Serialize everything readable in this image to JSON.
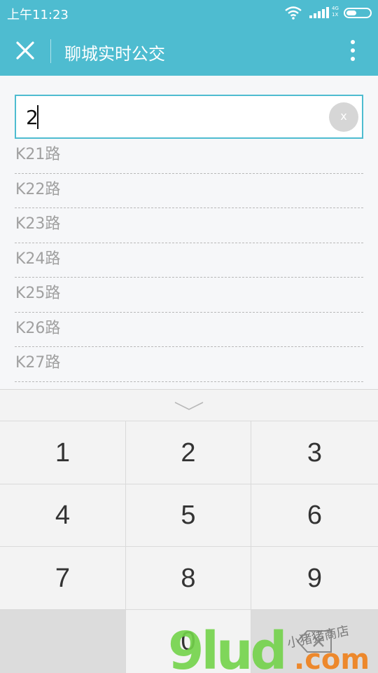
{
  "status_bar": {
    "time": "上午11:23",
    "network_top": "4G",
    "network_bottom": "1X",
    "icons": [
      "wifi-icon",
      "signal-icon",
      "battery-icon"
    ]
  },
  "app_bar": {
    "title": "聊城实时公交",
    "close_icon": "close-icon",
    "more_icon": "more-icon",
    "color": "#4ebcd0"
  },
  "search": {
    "value": "2",
    "clear_label": "x"
  },
  "suggestions": [
    "K21路",
    "K22路",
    "K23路",
    "K24路",
    "K25路",
    "K26路",
    "K27路"
  ],
  "keypad": {
    "collapse_icon": "chevron-down-icon",
    "keys": [
      "1",
      "2",
      "3",
      "4",
      "5",
      "6",
      "7",
      "8",
      "9",
      "",
      "0",
      ""
    ],
    "delete_icon": "backspace-icon"
  },
  "watermark": {
    "logo_text": "9lud",
    "domain_text": ".com",
    "tagline": "小猪猪商店"
  }
}
